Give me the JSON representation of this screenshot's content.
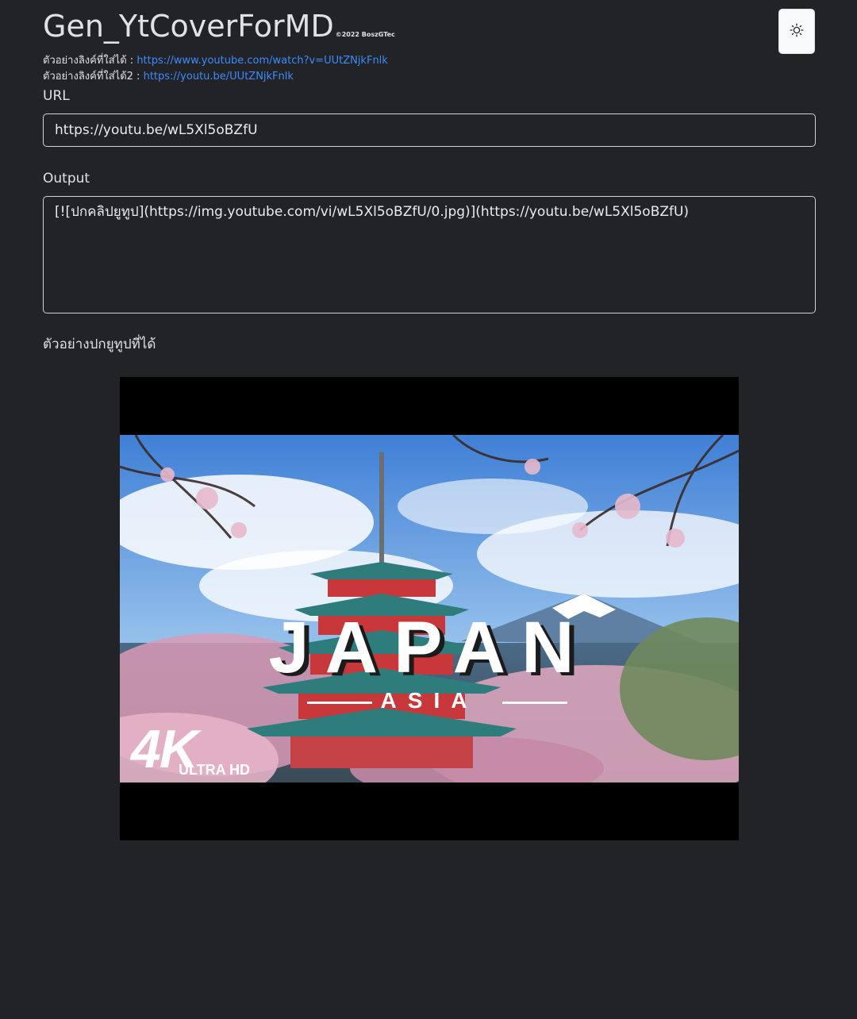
{
  "header": {
    "app_title": "Gen_YtCoverForMD",
    "copyright": "©2022 BoszGTec",
    "theme_toggle_icon": "sun-icon"
  },
  "examples": [
    {
      "label": "ตัวอย่างลิงค์ที่ใส่ได้ : ",
      "link": "https://www.youtube.com/watch?v=UUtZNjkFnlk"
    },
    {
      "label": "ตัวอย่างลิงค์ที่ใส่ได้2 : ",
      "link": "https://youtu.be/UUtZNjkFnlk"
    }
  ],
  "form": {
    "url_label": "URL",
    "url_value": "https://youtu.be/wL5Xl5oBZfU",
    "output_label": "Output",
    "output_value": "[![ปกคลิปยูทูป](https://img.youtube.com/vi/wL5Xl5oBZfU/0.jpg)](https://youtu.be/wL5Xl5oBZfU)"
  },
  "preview": {
    "label": "ตัวอย่างปกยูทูปที่ได้",
    "image_alt": "ปกคลิปยูทูป",
    "thumbnail_title": "JAPAN",
    "thumbnail_subtitle": "ASIA",
    "badge_main": "4K",
    "badge_sub": "ULTRA HD"
  },
  "colors": {
    "background": "#212327",
    "link": "#3d8bfd",
    "border": "#ced4da"
  }
}
